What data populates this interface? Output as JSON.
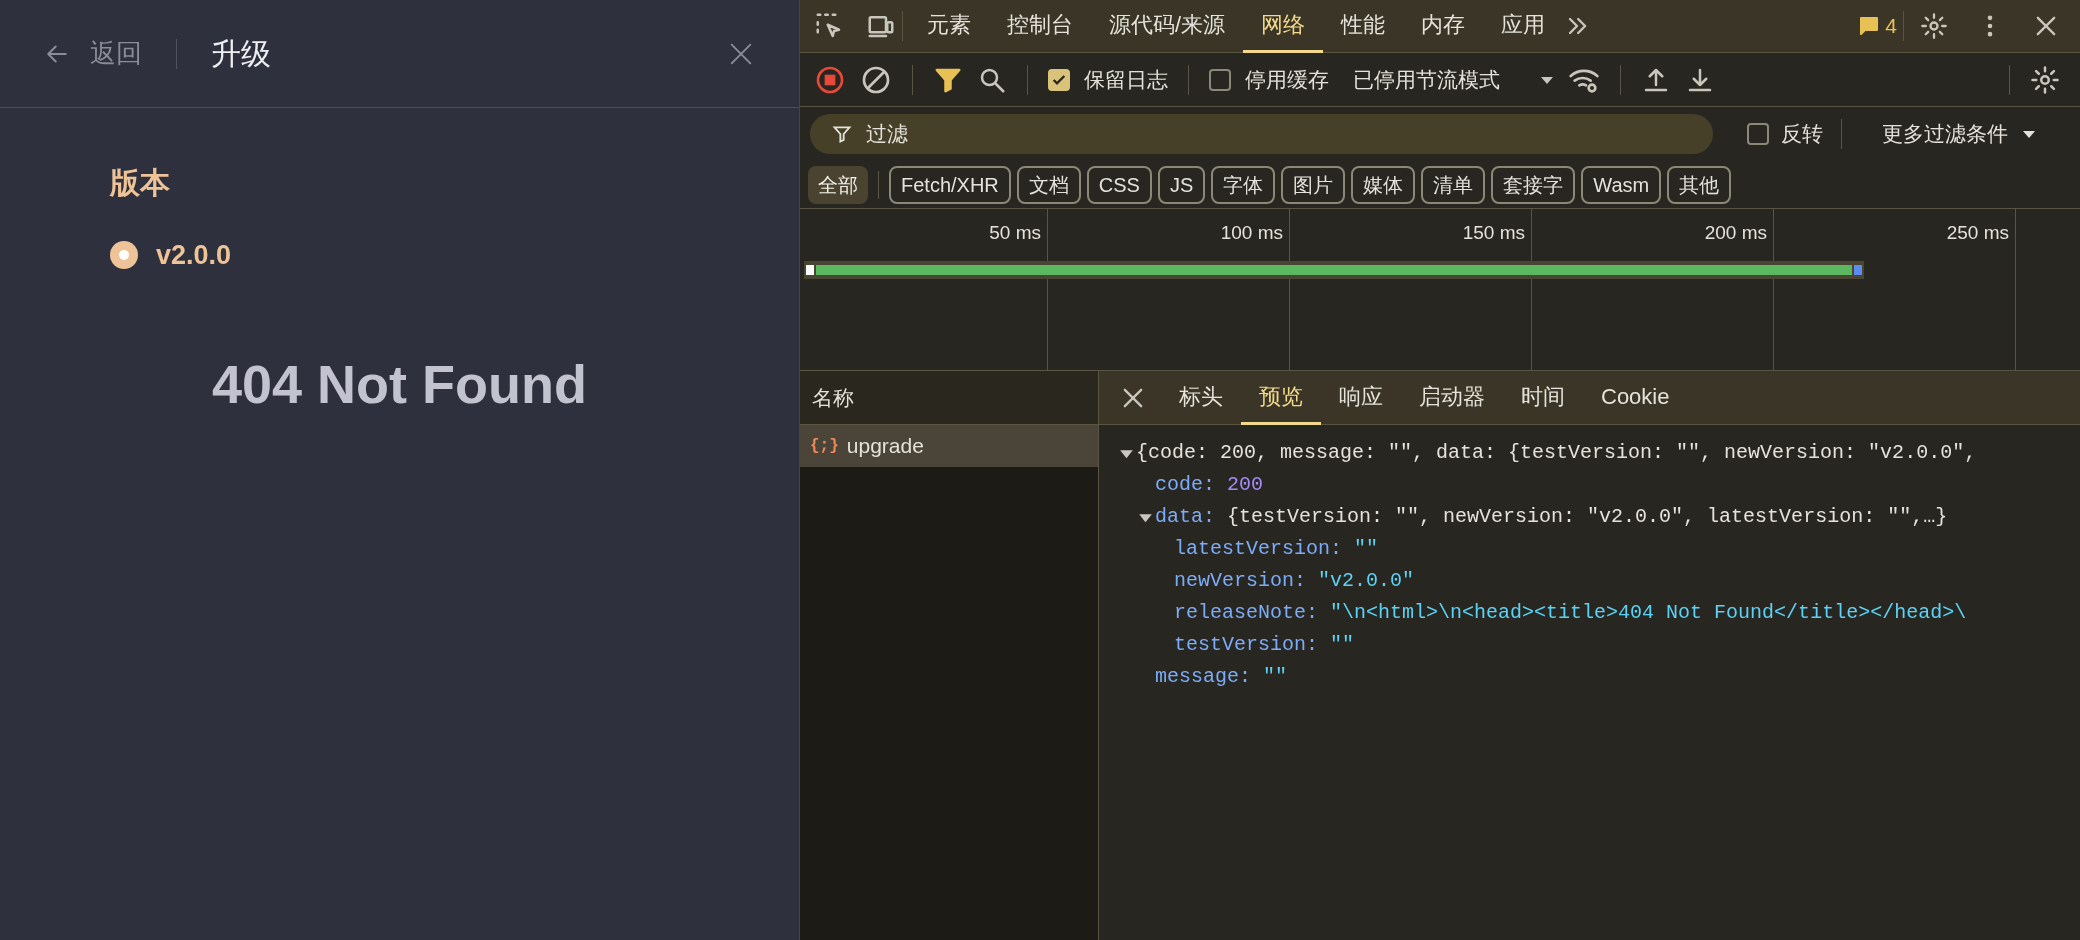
{
  "panel": {
    "back": "返回",
    "title": "升级",
    "section": "版本",
    "options": [
      {
        "label": "v2.0.0",
        "selected": true
      }
    ],
    "message": "404 Not Found"
  },
  "devtools": {
    "tabs": [
      {
        "label": "元素",
        "selected": false
      },
      {
        "label": "控制台",
        "selected": false
      },
      {
        "label": "源代码/来源",
        "selected": false
      },
      {
        "label": "网络",
        "selected": true
      },
      {
        "label": "性能",
        "selected": false
      },
      {
        "label": "内存",
        "selected": false
      },
      {
        "label": "应用",
        "selected": false
      }
    ],
    "issues_count": "4",
    "toolbar": {
      "recording": true,
      "filter_active": true,
      "preserve_log": {
        "label": "保留日志",
        "checked": true
      },
      "disable_cache": {
        "label": "停用缓存",
        "checked": false
      },
      "throttling": "已停用节流模式"
    },
    "filter": {
      "placeholder": "过滤",
      "invert": {
        "label": "反转",
        "checked": false
      },
      "more_filters": "更多过滤条件"
    },
    "types": [
      {
        "label": "全部",
        "selected": true
      },
      {
        "label": "Fetch/XHR",
        "selected": false
      },
      {
        "label": "文档",
        "selected": false
      },
      {
        "label": "CSS",
        "selected": false
      },
      {
        "label": "JS",
        "selected": false
      },
      {
        "label": "字体",
        "selected": false
      },
      {
        "label": "图片",
        "selected": false
      },
      {
        "label": "媒体",
        "selected": false
      },
      {
        "label": "清单",
        "selected": false
      },
      {
        "label": "套接字",
        "selected": false
      },
      {
        "label": "Wasm",
        "selected": false
      },
      {
        "label": "其他",
        "selected": false
      }
    ],
    "timeline": {
      "ticks": [
        "50 ms",
        "100 ms",
        "150 ms",
        "200 ms",
        "250 ms"
      ]
    },
    "requests": {
      "column": "名称",
      "rows": [
        {
          "icon": "{;}",
          "name": "upgrade",
          "selected": true
        }
      ]
    },
    "detail_tabs": [
      {
        "label": "标头",
        "selected": false
      },
      {
        "label": "预览",
        "selected": true
      },
      {
        "label": "响应",
        "selected": false
      },
      {
        "label": "启动器",
        "selected": false
      },
      {
        "label": "时间",
        "selected": false
      },
      {
        "label": "Cookie",
        "selected": false
      }
    ],
    "preview": {
      "value": "{code: 200, message: \"\", data: {testVersion: \"\", newVersion: \"v2.0.0\",",
      "kind": "object",
      "expanded": true,
      "children": [
        {
          "key": "code:",
          "value": "200",
          "kind": "number"
        },
        {
          "key": "data:",
          "value": "{testVersion: \"\", newVersion: \"v2.0.0\", latestVersion: \"\",…}",
          "kind": "object",
          "expanded": true,
          "children": [
            {
              "key": "latestVersion:",
              "value": "\"\"",
              "kind": "string"
            },
            {
              "key": "newVersion:",
              "value": "\"v2.0.0\"",
              "kind": "string"
            },
            {
              "key": "releaseNote:",
              "value": "\"\\n<html>\\n<head><title>404 Not Found</title></head>\\",
              "kind": "string"
            },
            {
              "key": "testVersion:",
              "value": "\"\"",
              "kind": "string"
            }
          ]
        },
        {
          "key": "message:",
          "value": "\"\"",
          "kind": "string"
        }
      ]
    }
  }
}
